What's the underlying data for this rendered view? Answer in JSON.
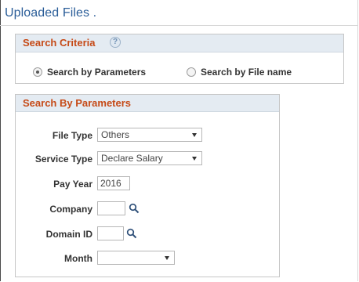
{
  "page": {
    "title": "Uploaded Files ."
  },
  "search_criteria": {
    "title": "Search Criteria",
    "help_icon": "help-icon",
    "options": [
      {
        "label": "Search by Parameters",
        "selected": true
      },
      {
        "label": "Search by File name",
        "selected": false
      }
    ]
  },
  "search_by_parameters": {
    "title": "Search By Parameters",
    "file_type": {
      "label": "File Type",
      "value": "Others"
    },
    "service_type": {
      "label": "Service Type",
      "value": "Declare Salary"
    },
    "pay_year": {
      "label": "Pay Year",
      "value": "2016"
    },
    "company": {
      "label": "Company",
      "value": "",
      "lookup_icon": "search-icon"
    },
    "domain_id": {
      "label": "Domain ID",
      "value": "",
      "lookup_icon": "search-icon"
    },
    "month": {
      "label": "Month",
      "value": ""
    }
  },
  "colors": {
    "title": "#2a5d98",
    "group_title": "#c64a17",
    "group_header_bg": "#e4ebf2"
  }
}
